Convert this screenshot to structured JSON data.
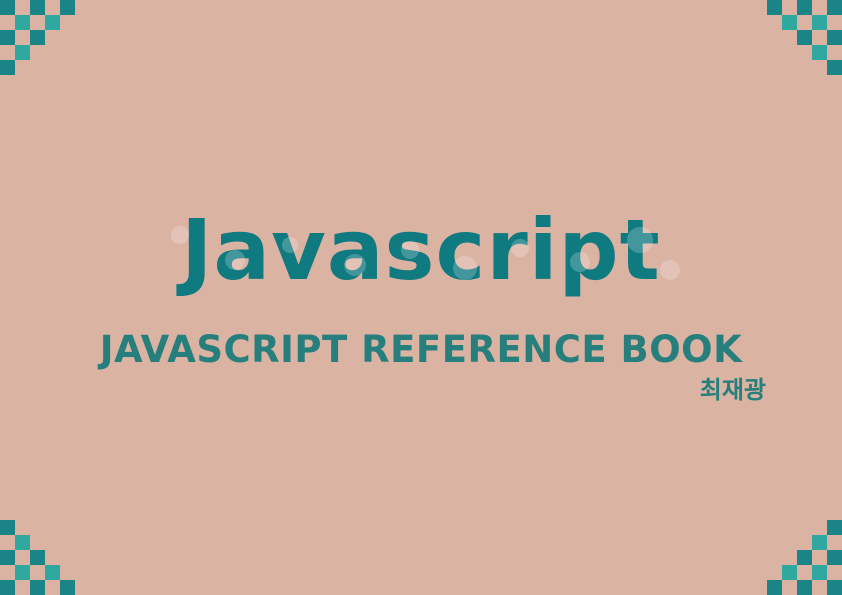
{
  "cover": {
    "title": "Javascript",
    "subtitle": "JAVASCRIPT REFERENCE BOOK",
    "author": "최재광"
  },
  "colors": {
    "background": "#dbb3a3",
    "title": "#0f7a80",
    "subtitle": "#267f7c",
    "pixel_dark": "#1b8486",
    "pixel_light": "#2fa8a0"
  },
  "decorations": {
    "corner_pattern": "pixel-checkerboard"
  }
}
